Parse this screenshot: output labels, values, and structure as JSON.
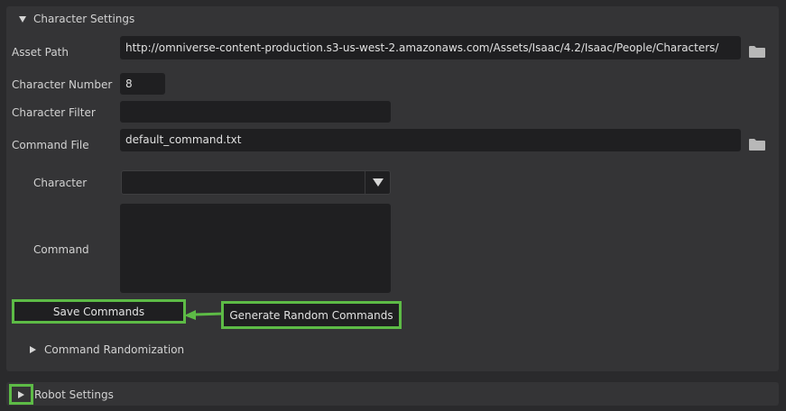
{
  "character_settings": {
    "title": "Character Settings",
    "asset_path": {
      "label": "Asset Path",
      "value": "http://omniverse-content-production.s3-us-west-2.amazonaws.com/Assets/Isaac/4.2/Isaac/People/Characters/"
    },
    "character_number": {
      "label": "Character Number",
      "value": "8"
    },
    "character_filter": {
      "label": "Character Filter",
      "value": ""
    },
    "command_file": {
      "label": "Command File",
      "value": "default_command.txt"
    },
    "character": {
      "label": "Character",
      "selected": ""
    },
    "command": {
      "label": "Command",
      "value": ""
    },
    "save_commands_label": "Save Commands",
    "generate_random_commands_label": "Generate Random Commands",
    "command_randomization_title": "Command Randomization"
  },
  "robot_settings": {
    "title": "Robot Settings"
  },
  "colors": {
    "background": "#2a2a2c",
    "panel": "#343436",
    "field": "#1f1f21",
    "highlight": "#5dbb46"
  },
  "icons": {
    "expand": "triangle-down-icon",
    "collapse": "triangle-right-icon",
    "folder": "folder-icon",
    "dropdown": "chevron-down-icon"
  }
}
